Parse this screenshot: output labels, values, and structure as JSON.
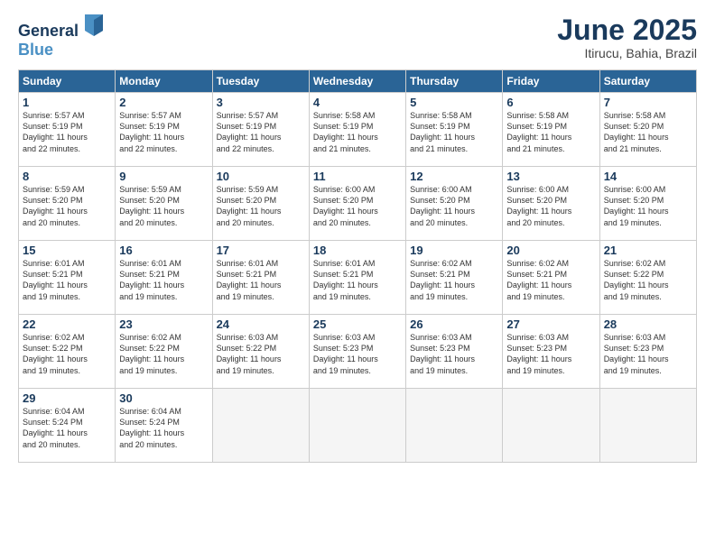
{
  "header": {
    "logo_line1": "General",
    "logo_line2": "Blue",
    "month_title": "June 2025",
    "location": "Itirucu, Bahia, Brazil"
  },
  "weekdays": [
    "Sunday",
    "Monday",
    "Tuesday",
    "Wednesday",
    "Thursday",
    "Friday",
    "Saturday"
  ],
  "weeks": [
    [
      {
        "day": "1",
        "info": "Sunrise: 5:57 AM\nSunset: 5:19 PM\nDaylight: 11 hours\nand 22 minutes."
      },
      {
        "day": "2",
        "info": "Sunrise: 5:57 AM\nSunset: 5:19 PM\nDaylight: 11 hours\nand 22 minutes."
      },
      {
        "day": "3",
        "info": "Sunrise: 5:57 AM\nSunset: 5:19 PM\nDaylight: 11 hours\nand 22 minutes."
      },
      {
        "day": "4",
        "info": "Sunrise: 5:58 AM\nSunset: 5:19 PM\nDaylight: 11 hours\nand 21 minutes."
      },
      {
        "day": "5",
        "info": "Sunrise: 5:58 AM\nSunset: 5:19 PM\nDaylight: 11 hours\nand 21 minutes."
      },
      {
        "day": "6",
        "info": "Sunrise: 5:58 AM\nSunset: 5:19 PM\nDaylight: 11 hours\nand 21 minutes."
      },
      {
        "day": "7",
        "info": "Sunrise: 5:58 AM\nSunset: 5:20 PM\nDaylight: 11 hours\nand 21 minutes."
      }
    ],
    [
      {
        "day": "8",
        "info": "Sunrise: 5:59 AM\nSunset: 5:20 PM\nDaylight: 11 hours\nand 20 minutes."
      },
      {
        "day": "9",
        "info": "Sunrise: 5:59 AM\nSunset: 5:20 PM\nDaylight: 11 hours\nand 20 minutes."
      },
      {
        "day": "10",
        "info": "Sunrise: 5:59 AM\nSunset: 5:20 PM\nDaylight: 11 hours\nand 20 minutes."
      },
      {
        "day": "11",
        "info": "Sunrise: 6:00 AM\nSunset: 5:20 PM\nDaylight: 11 hours\nand 20 minutes."
      },
      {
        "day": "12",
        "info": "Sunrise: 6:00 AM\nSunset: 5:20 PM\nDaylight: 11 hours\nand 20 minutes."
      },
      {
        "day": "13",
        "info": "Sunrise: 6:00 AM\nSunset: 5:20 PM\nDaylight: 11 hours\nand 20 minutes."
      },
      {
        "day": "14",
        "info": "Sunrise: 6:00 AM\nSunset: 5:20 PM\nDaylight: 11 hours\nand 19 minutes."
      }
    ],
    [
      {
        "day": "15",
        "info": "Sunrise: 6:01 AM\nSunset: 5:21 PM\nDaylight: 11 hours\nand 19 minutes."
      },
      {
        "day": "16",
        "info": "Sunrise: 6:01 AM\nSunset: 5:21 PM\nDaylight: 11 hours\nand 19 minutes."
      },
      {
        "day": "17",
        "info": "Sunrise: 6:01 AM\nSunset: 5:21 PM\nDaylight: 11 hours\nand 19 minutes."
      },
      {
        "day": "18",
        "info": "Sunrise: 6:01 AM\nSunset: 5:21 PM\nDaylight: 11 hours\nand 19 minutes."
      },
      {
        "day": "19",
        "info": "Sunrise: 6:02 AM\nSunset: 5:21 PM\nDaylight: 11 hours\nand 19 minutes."
      },
      {
        "day": "20",
        "info": "Sunrise: 6:02 AM\nSunset: 5:21 PM\nDaylight: 11 hours\nand 19 minutes."
      },
      {
        "day": "21",
        "info": "Sunrise: 6:02 AM\nSunset: 5:22 PM\nDaylight: 11 hours\nand 19 minutes."
      }
    ],
    [
      {
        "day": "22",
        "info": "Sunrise: 6:02 AM\nSunset: 5:22 PM\nDaylight: 11 hours\nand 19 minutes."
      },
      {
        "day": "23",
        "info": "Sunrise: 6:02 AM\nSunset: 5:22 PM\nDaylight: 11 hours\nand 19 minutes."
      },
      {
        "day": "24",
        "info": "Sunrise: 6:03 AM\nSunset: 5:22 PM\nDaylight: 11 hours\nand 19 minutes."
      },
      {
        "day": "25",
        "info": "Sunrise: 6:03 AM\nSunset: 5:23 PM\nDaylight: 11 hours\nand 19 minutes."
      },
      {
        "day": "26",
        "info": "Sunrise: 6:03 AM\nSunset: 5:23 PM\nDaylight: 11 hours\nand 19 minutes."
      },
      {
        "day": "27",
        "info": "Sunrise: 6:03 AM\nSunset: 5:23 PM\nDaylight: 11 hours\nand 19 minutes."
      },
      {
        "day": "28",
        "info": "Sunrise: 6:03 AM\nSunset: 5:23 PM\nDaylight: 11 hours\nand 19 minutes."
      }
    ],
    [
      {
        "day": "29",
        "info": "Sunrise: 6:04 AM\nSunset: 5:24 PM\nDaylight: 11 hours\nand 20 minutes."
      },
      {
        "day": "30",
        "info": "Sunrise: 6:04 AM\nSunset: 5:24 PM\nDaylight: 11 hours\nand 20 minutes."
      },
      {
        "day": "",
        "info": ""
      },
      {
        "day": "",
        "info": ""
      },
      {
        "day": "",
        "info": ""
      },
      {
        "day": "",
        "info": ""
      },
      {
        "day": "",
        "info": ""
      }
    ]
  ]
}
